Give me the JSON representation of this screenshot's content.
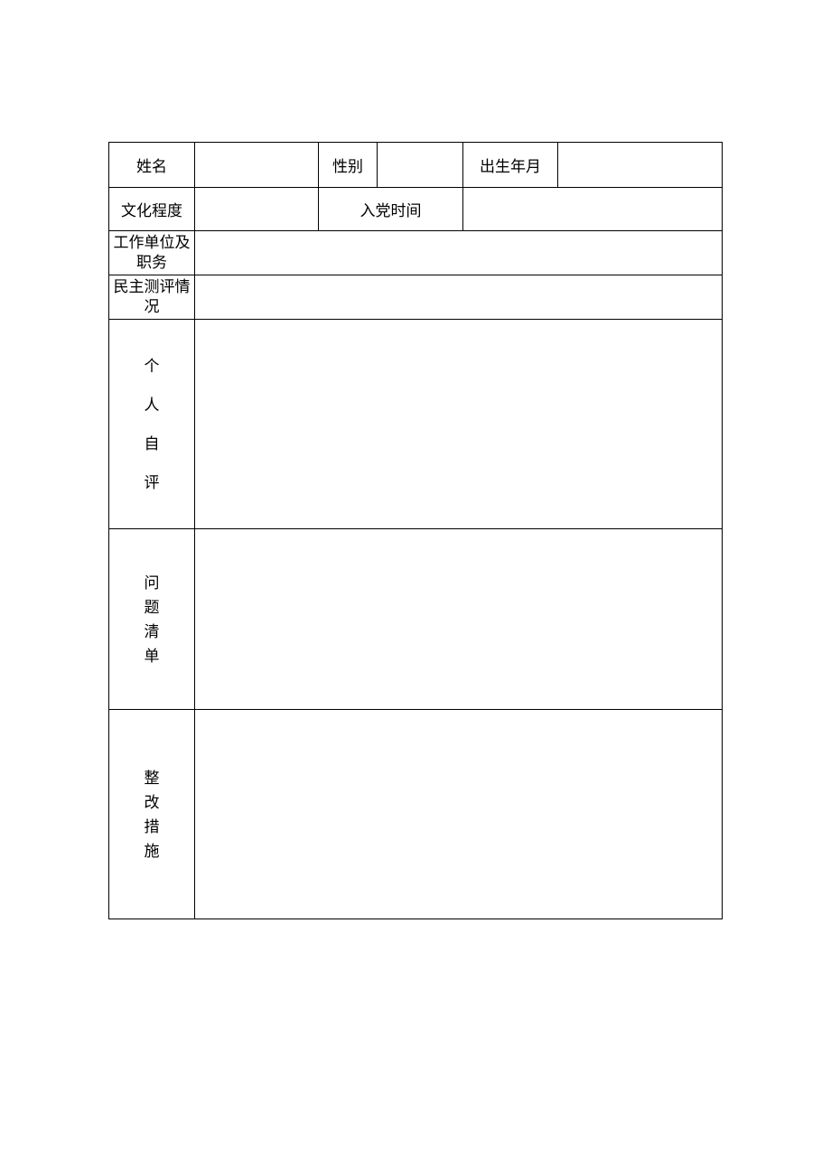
{
  "form": {
    "row1": {
      "name_label": "姓名",
      "name_value": "",
      "sex_label": "性别",
      "sex_value": "",
      "dob_label": "出生年月",
      "dob_value": ""
    },
    "row2": {
      "edu_label": "文化程度",
      "edu_value": "",
      "party_label": "入党时间",
      "party_value": ""
    },
    "row3": {
      "work_label": "工作单位及职务",
      "work_value": ""
    },
    "row4": {
      "eval_label": "民主测评情况",
      "eval_value": ""
    },
    "row5": {
      "self_label_chars": [
        "个",
        "人",
        "自",
        "评"
      ],
      "self_value": ""
    },
    "row6": {
      "issue_label_chars": [
        "问",
        "题",
        "清",
        "单"
      ],
      "issue_value": ""
    },
    "row7": {
      "rect_label_chars": [
        "整",
        "改",
        "措",
        "施"
      ],
      "rect_value": ""
    }
  }
}
